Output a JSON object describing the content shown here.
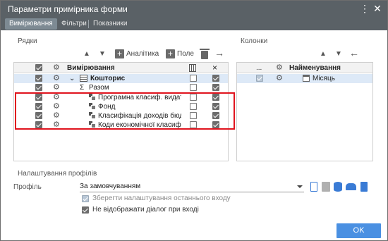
{
  "window": {
    "title": "Параметри примірника форми",
    "menu_icon": "⋮",
    "close_icon": "✕"
  },
  "tabs": [
    {
      "label": "Вимірювання",
      "active": true
    },
    {
      "label": "Фільтри",
      "active": false
    },
    {
      "label": "Показники",
      "active": false
    }
  ],
  "rows_section": {
    "label": "Рядки",
    "toolbar": {
      "up": "▲",
      "down": "▼",
      "add_analytics_label": "Аналітика",
      "add_field_label": "Поле",
      "move_right": "→"
    },
    "header": {
      "name": "Вимірювання",
      "x_icon": "×"
    },
    "items": [
      {
        "name": "Кошторис",
        "bold": true,
        "checked": true,
        "c3": false,
        "c4": true,
        "selected": true,
        "icon": "table-icon",
        "indent": 0,
        "expand": "⌄"
      },
      {
        "name": "Разом",
        "bold": false,
        "checked": true,
        "c3": false,
        "c4": true,
        "selected": false,
        "icon": "sigma-icon",
        "indent": 1,
        "sigma": "Σ"
      },
      {
        "name": "Програмна класиф. видатків",
        "bold": false,
        "checked": true,
        "c3": false,
        "c4": true,
        "selected": false,
        "icon": "dimension-icon",
        "indent": 1
      },
      {
        "name": "Фонд",
        "bold": false,
        "checked": true,
        "c3": false,
        "c4": true,
        "selected": false,
        "icon": "dimension-icon",
        "indent": 1
      },
      {
        "name": "Класифікація доходів бюджету",
        "bold": false,
        "checked": true,
        "c3": false,
        "c4": true,
        "selected": false,
        "icon": "dimension-icon",
        "indent": 1
      },
      {
        "name": "Коди економічної класифікації",
        "bold": false,
        "checked": true,
        "c3": false,
        "c4": true,
        "selected": false,
        "icon": "dimension-icon",
        "indent": 1
      }
    ]
  },
  "columns_section": {
    "label": "Колонки",
    "toolbar": {
      "up": "▲",
      "down": "▼",
      "move_left": "←"
    },
    "header": {
      "dots": "...",
      "name": "Найменування"
    },
    "items": [
      {
        "name": "Місяць",
        "checked": true,
        "disabled": true,
        "icon": "calendar-icon"
      }
    ]
  },
  "profiles": {
    "section_label": "Налаштування профілів",
    "profile_label": "Профіль",
    "profile_value": "За замовчуванням",
    "save_last_input_label": "Зберегти налаштування останнього входу",
    "save_last_input_checked": true,
    "save_last_input_disabled": true,
    "hide_dialog_label": "Не відображати діалог при вході",
    "hide_dialog_checked": true
  },
  "ok_label": "OK",
  "colors": {
    "titlebar": "#5a6166",
    "accent": "#4a90e2",
    "highlight": "#e0141e"
  }
}
